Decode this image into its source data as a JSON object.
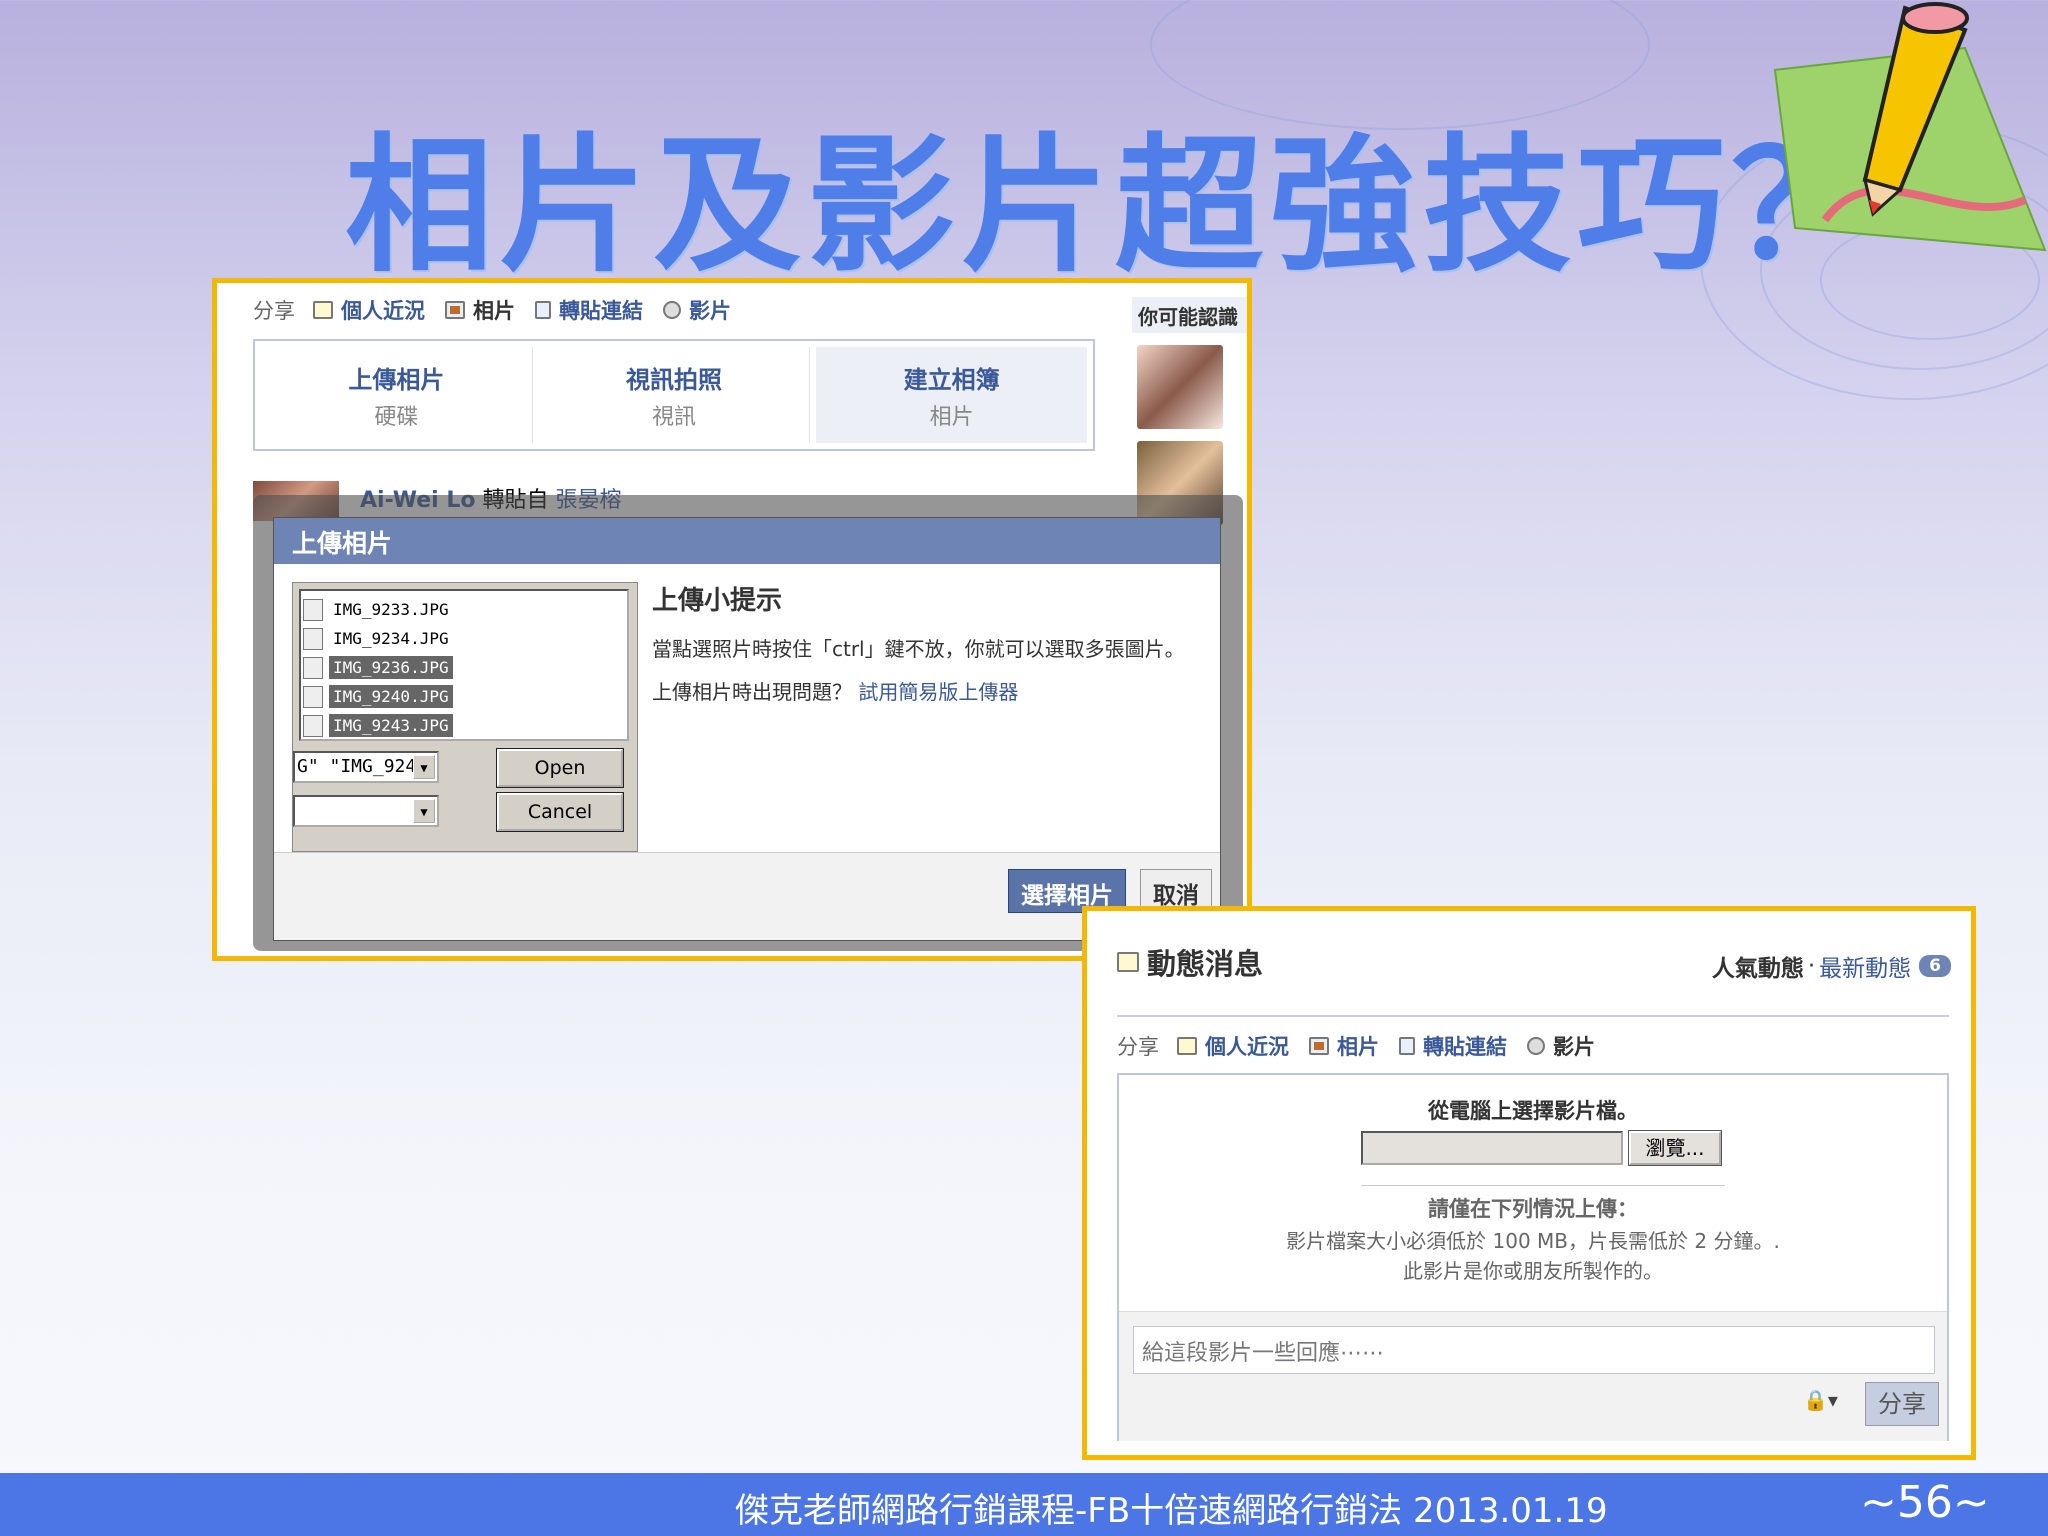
{
  "slide": {
    "title": "相片及影片超強技巧？"
  },
  "shot1": {
    "share_bar": {
      "label": "分享",
      "items": [
        "個人近況",
        "相片",
        "轉貼連結",
        "影片"
      ]
    },
    "upload_options": [
      {
        "title": "上傳相片",
        "sub": "硬碟"
      },
      {
        "title": "視訊拍照",
        "sub": "視訊"
      },
      {
        "title": "建立相簿",
        "sub": "相片"
      }
    ],
    "side_heading": "你可能認識",
    "post": {
      "author": "Ai-Wei Lo",
      "action": "轉貼自",
      "source": "張晏榕"
    },
    "dialog": {
      "title": "上傳相片",
      "files": [
        "IMG_9233.JPG",
        "IMG_9234.JPG",
        "IMG_9236.JPG",
        "IMG_9240.JPG",
        "IMG_9243.JPG"
      ],
      "filename_value": "G\" \"IMG_924(",
      "filetype_value": "",
      "open_label": "Open",
      "cancel_label": "Cancel",
      "tips_heading": "上傳小提示",
      "tips_line1": "當點選照片時按住「ctrl」鍵不放，你就可以選取多張圖片。",
      "tips_line2_text": "上傳相片時出現問題？",
      "tips_line2_link": "試用簡易版上傳器",
      "choose_label": "選擇相片",
      "cancel_fb_label": "取消"
    }
  },
  "shot2": {
    "heading": "動態消息",
    "tab_top": "人氣動態",
    "tab_dot": "·",
    "tab_recent": "最新動態",
    "badge": "6",
    "share_bar": {
      "label": "分享",
      "items": [
        "個人近況",
        "相片",
        "轉貼連結",
        "影片"
      ]
    },
    "choose_video": "從電腦上選擇影片檔。",
    "browse_label": "瀏覽...",
    "req_heading": "請僅在下列情況上傳：",
    "req_line1": "影片檔案大小必須低於 100 MB，片長需低於 2 分鐘。.",
    "req_line2": "此影片是你或朋友所製作的。",
    "comment_placeholder": "給這段影片一些回應⋯⋯",
    "share_label": "分享"
  },
  "footer": {
    "text": "傑克老師網路行銷課程-FB十倍速網路行銷法 2013.01.19",
    "page": "~56~"
  }
}
